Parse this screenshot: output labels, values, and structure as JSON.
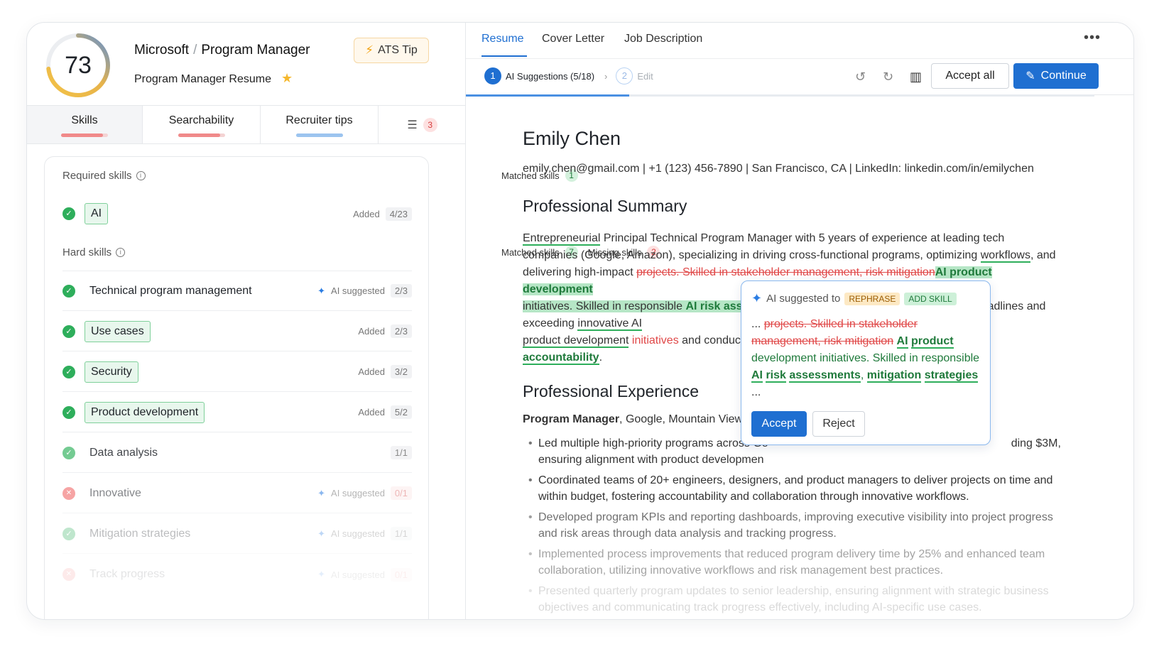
{
  "header": {
    "score": "73",
    "score_fraction": 0.73,
    "company": "Microsoft",
    "separator": "/",
    "role": "Program Manager",
    "resume_name": "Program Manager Resume",
    "ats_tip_label": "ATS Tip"
  },
  "left_tabs": [
    {
      "label": "Skills",
      "progress": 0.9,
      "color": "#f08a8a"
    },
    {
      "label": "Searchability",
      "progress": 0.9,
      "color": "#f08a8a"
    },
    {
      "label": "Recruiter tips",
      "progress": 1.0,
      "color": "#9cc4ef"
    }
  ],
  "filter_count": "3",
  "required": {
    "title": "Required skills",
    "matched_label": "Matched skills",
    "matched_count": "1",
    "items": [
      {
        "name": "AI",
        "status": "Added",
        "ratio": "4/23"
      }
    ]
  },
  "hard": {
    "title": "Hard skills",
    "matched_label": "Matched skills",
    "matched_count": "7",
    "missing_label": "Missing skills",
    "missing_count": "2",
    "items": [
      {
        "name": "Technical program management",
        "status": "AI suggested",
        "ratio": "2/3"
      },
      {
        "name": "Use cases",
        "status": "Added",
        "ratio": "2/3"
      },
      {
        "name": "Security",
        "status": "Added",
        "ratio": "3/2"
      },
      {
        "name": "Product development",
        "status": "Added",
        "ratio": "5/2"
      },
      {
        "name": "Data analysis",
        "status": "",
        "ratio": "1/1"
      },
      {
        "name": "Innovative",
        "status": "AI suggested",
        "ratio": "0/1"
      },
      {
        "name": "Mitigation strategies",
        "status": "AI suggested",
        "ratio": "1/1"
      },
      {
        "name": "Track progress",
        "status": "AI suggested",
        "ratio": "0/1"
      }
    ]
  },
  "right_tabs": [
    "Resume",
    "Cover Letter",
    "Job Description"
  ],
  "steps": {
    "step1_num": "1",
    "step1_label": "AI Suggestions (5/18)",
    "step2_num": "2",
    "step2_label": "Edit",
    "accept_all": "Accept all",
    "continue": "Continue",
    "progress": 0.26
  },
  "resume": {
    "name": "Emily Chen",
    "contact": "emily.chen@gmail.com | +1 (123) 456-7890 | San Francisco, CA | LinkedIn: linkedin.com/in/emilychen",
    "summary_title": "Professional Summary",
    "summary": {
      "w1": "Entrepreneurial",
      "t1": " Principal Technical Program Manager with 5 years of experience at leading tech companies (Google, Amazon), specializing in driving cross-functional programs, optimizing ",
      "w2": "workflows",
      "t2": ", and delivering high-impact ",
      "del1": "projects. Skilled in stakeholder management, risk mitigation",
      "ins1": "AI product development",
      "ins2": "initiatives. Skilled in responsible ",
      "ins3": "AI risk assessments",
      "t3": " with a track record of meeting tight deadlines and exceeding ",
      "t4": "innovative AI",
      "t5": "product development",
      "del2": "initiatives",
      "t6": " and conduct ",
      "t7": "and",
      "w3": "accountability",
      "t8": "."
    },
    "experience_title": "Professional Experience",
    "job_title": "Program Manager",
    "job_meta": ", Google, Mountain View, CA –",
    "bullets": [
      "Led multiple high-priority programs across Google, managing budgets exceeding $3M, ensuring alignment with product development goals.",
      "Coordinated teams of 20+ engineers, designers, and product managers to deliver projects on time and within budget, fostering accountability and collaboration through innovative workflows.",
      "Developed program KPIs and reporting dashboards, improving executive visibility into project progress and risk areas through data analysis and tracking progress.",
      "Implemented process improvements that reduced program delivery time by 25% and enhanced team collaboration, utilizing innovative workflows and risk management best practices.",
      "Presented quarterly program updates to senior leadership, ensuring alignment with strategic business objectives and communicating track progress effectively, including AI-specific use cases."
    ],
    "bullet1_visible_start": "Led multiple high-priority programs across Go",
    "bullet1_visible_end": "ding $3M,",
    "bullet1_line2": "ensuring alignment with product developmen"
  },
  "popup": {
    "title": "AI suggested to",
    "tag1": "REPHRASE",
    "tag2": "ADD SKILL",
    "prefix": "... ",
    "deleted": "projects. Skilled in stakeholder management, risk mitigation",
    "ins_ai": "AI",
    "ins_product": "product",
    "ins_mid": " development initiatives. Skilled in responsible ",
    "ins_ai2": "AI",
    "ins_risk": "risk",
    "ins_assess": "assessments",
    "comma": ",",
    "ins_mit": "mitigation",
    "ins_strat": "strategies",
    "suffix": "...",
    "accept": "Accept",
    "reject": "Reject"
  }
}
